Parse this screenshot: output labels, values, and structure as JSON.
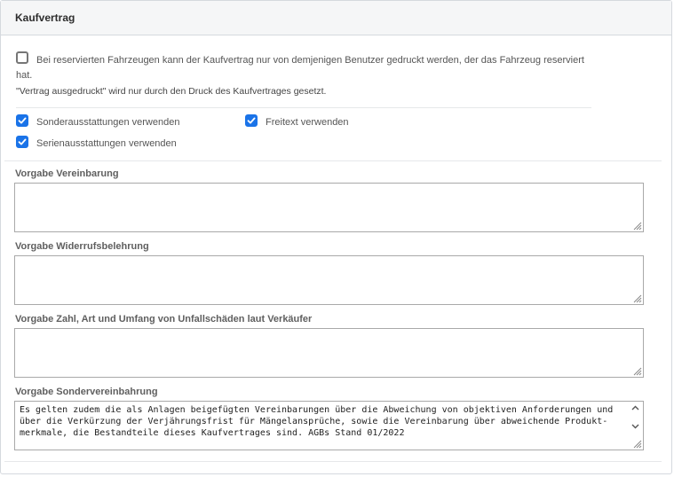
{
  "panel": {
    "title": "Kaufvertrag"
  },
  "reserved_option": {
    "checked": false,
    "label_line1": "Bei reservierten Fahrzeugen kann der Kaufvertrag nur von demjenigen Benutzer gedruckt werden, der das Fahrzeug reserviert",
    "label_line2": "hat.",
    "note": "\"Vertrag ausgedruckt\" wird nur durch den Druck des Kaufvertrages gesetzt."
  },
  "options": [
    {
      "label": "Sonderausstattungen verwenden",
      "checked": true
    },
    {
      "label": "Freitext verwenden",
      "checked": true
    },
    {
      "label": "Serienausstattungen verwenden",
      "checked": true
    }
  ],
  "fields": [
    {
      "label": "Vorgabe Vereinbarung",
      "value": ""
    },
    {
      "label": "Vorgabe Widerrufsbelehrung",
      "value": ""
    },
    {
      "label": "Vorgabe Zahl, Art und Umfang von Unfallschäden laut Verkäufer",
      "value": ""
    },
    {
      "label": "Vorgabe Sondervereinbahrung",
      "value_lines": [
        "Es gelten zudem die als Anlagen beigefügten Vereinbarungen über die Abweichung von objektiven Anforderungen und",
        "über die Verkürzung der Verjährungsfrist für Mängelansprüche, sowie die Vereinbarung über abweichende Produkt-",
        "merkmale, die Bestandteile dieses Kaufvertrages sind. AGBs Stand 01/2022"
      ]
    }
  ],
  "colors": {
    "accent": "#1a73e8",
    "border": "#d5d9de"
  },
  "icons": {
    "check": "check-icon",
    "grip": "resize-grip-icon",
    "scroll_up": "chevron-up-icon",
    "scroll_down": "chevron-down-icon"
  }
}
